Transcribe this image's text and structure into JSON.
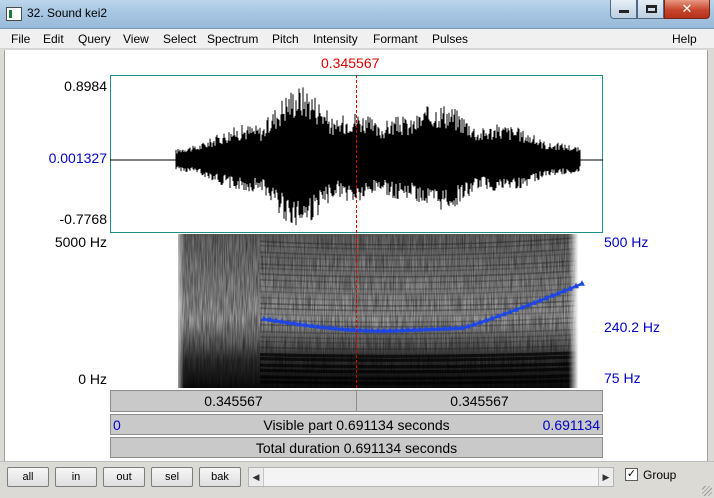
{
  "window": {
    "title": "32. Sound kei2",
    "minimize_glyph": "",
    "maximize_glyph": "",
    "close_glyph": "✕"
  },
  "menu": [
    "File",
    "Edit",
    "Query",
    "View",
    "Select",
    "Spectrum",
    "Pitch",
    "Intensity",
    "Formant",
    "Pulses",
    "Help"
  ],
  "cursor": {
    "time_label": "0.345567"
  },
  "waveform": {
    "max_label": "0.8984",
    "mid_label": "0.001327",
    "min_label": "-0.7768"
  },
  "spectrogram": {
    "top_label": "5000 Hz",
    "bottom_label": "0 Hz"
  },
  "pitch": {
    "top_label": "500 Hz",
    "mid_label": "240.2 Hz",
    "bottom_label": "75 Hz"
  },
  "time_bars": {
    "left_segment": "0.345567",
    "right_segment": "0.345567",
    "visible_start": "0",
    "visible_label": "Visible part 0.691134 seconds",
    "visible_end": "0.691134",
    "total_label": "Total duration 0.691134 seconds"
  },
  "toolbar": {
    "buttons": [
      "all",
      "in",
      "out",
      "sel",
      "bak"
    ],
    "scroll_left": "◀",
    "scroll_right": "▶",
    "group_check": "✓",
    "group_label": "Group"
  },
  "colors": {
    "cursor": "#e00000",
    "axis_blue": "#0000c8",
    "frame": "#1e8c8c",
    "pitch_line": "#1e46e6"
  }
}
